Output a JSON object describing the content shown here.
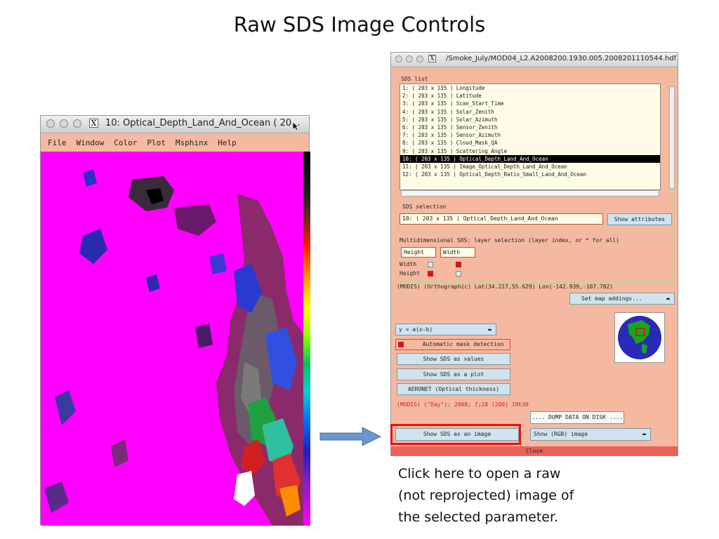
{
  "slide": {
    "title": "Raw SDS Image Controls",
    "caption": [
      "Click here to open a raw",
      "(not reprojected) image of",
      "the selected parameter."
    ]
  },
  "image_window": {
    "title": "10: Optical_Depth_Land_And_Ocean ( 20...",
    "close_glyph": "X",
    "menu": [
      "File",
      "Window",
      "Color",
      "Plot",
      "Msphinx",
      "Help"
    ]
  },
  "dialog": {
    "title": "/Smoke_July/MOD04_L2.A2008200.1930.005.2008201110544.hdf",
    "close_glyph": "X",
    "sds_list_label": "SDS  list",
    "sds_list": [
      "1: (  203 x  135 ) Longitude",
      "2: (  203 x  135 ) Latitude",
      "3: (  203 x  135 ) Scan_Start_Time",
      "4: (  203 x  135 ) Solar_Zenith",
      "5: (  203 x  135 ) Solar_Azimuth",
      "6: (  203 x  135 ) Sensor_Zenith",
      "7: (  203 x  135 ) Sensor_Azimuth",
      "8: (  203 x  135 ) Cloud_Mask_QA",
      "9: (  203 x  135 ) Scattering_Angle",
      "10: (  203 x  135 ) Optical_Depth_Land_And_Ocean",
      "11: (  203 x  135 ) Image_Optical_Depth_Land_And_Ocean",
      "12: (  203 x  135 ) Optical_Depth_Ratio_Small_Land_And_Ocean"
    ],
    "selected_index": 9,
    "sds_selection_label": "SDS  selection",
    "sds_selection_value": "10: (  203 x  135 ) Optical_Depth_Land_And_Ocean",
    "show_attributes": "Show attributes",
    "multidim_label": "Multidimensional SDS: layer selection (layer index, or * for all)",
    "height_field": "Height",
    "width_field": "Width",
    "width_label": "Width",
    "height_label": "Height",
    "proj_info": "(MODIS) (Orthographic) Lat(34.217,55.629) Lon(-142.939,-107.782)",
    "map_addings": "Set map addings...",
    "formula": "y = a(x-b)",
    "auto_mask": "Automatic mask detection",
    "show_values": "Show SDS as values",
    "show_plot": "Show SDS as a plot",
    "aeronet": "AERONET (Optical thickness)",
    "date_info": "(MODIS) (\"Day\"); 2008; 7;18 (200) 19h30",
    "dump": ".... DUMP DATA ON DISK ....",
    "show_image": "Show SDS as an image",
    "rgb_image": "Show (RGB) image",
    "close": "Close"
  },
  "colors": {
    "dialog_bg": "#f4b9a0",
    "highlight": "#ee1111",
    "arrow": "#6a96cc",
    "image_bg": "#ff00ff"
  }
}
